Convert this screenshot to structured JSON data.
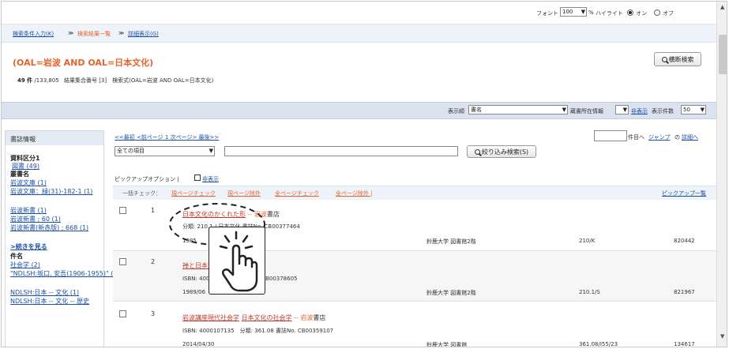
{
  "topbar": {
    "font_label": "フォント",
    "font_value": "100",
    "percent_label": "%",
    "highlight_label": "ハイライト",
    "on_label": "オン",
    "off_label": "オフ"
  },
  "breadcrumb": {
    "step1": "検索条件入力(K)",
    "step2": "検索結果一覧",
    "step3": "詳細表示(G)",
    "sep": "≫"
  },
  "query": {
    "title": "(OAL=岩波 AND OAL=日本文化)",
    "count": "49 件",
    "total": "/133,805",
    "info": "結果集合番号 [3]　検索式(OAL=岩波 AND OAL=日本文化)",
    "cross_search": "横断検索"
  },
  "display_bar": {
    "order_label": "表示順",
    "order_value": "書名",
    "holdings_label": "蔵書所在情報",
    "hide_label": "非表示",
    "count_label": "表示件数",
    "count_value": "50"
  },
  "pager": {
    "text": "<<最初 <前ページ 1 次ページ> 最後>>",
    "jump_suffix": "件目へ",
    "jump": "ジャンプ",
    "prev_sep": "の",
    "detail": "詳細へ"
  },
  "filter": {
    "scope": "全ての項目",
    "button": "絞り込み検索(S)"
  },
  "pickup": {
    "label": "ピックアップオプション |",
    "hide": "非表示",
    "bulk": "一括チェック：",
    "page_check": "現ページチェック",
    "page_exclude": "現ページ除外",
    "all_check": "全ページチェック",
    "all_exclude": "全ページ除外 |",
    "list": "ピックアップ一覧"
  },
  "sidebar": {
    "title": "書誌情報",
    "sections": [
      {
        "head": "資料区分1",
        "items": [
          "図書 (49)"
        ]
      },
      {
        "head": "叢書名",
        "items": [
          "岩波文庫 (1)",
          "岩波文庫：緑(31)-182-1 (1)",
          "岩波新書 (1)",
          "岩波新書 ; 60 (1)",
          "岩波新書(新赤版) ; 668 (1)"
        ]
      },
      {
        "head": "",
        "items": [
          ">続きを見る"
        ]
      },
      {
        "head": "件名",
        "items": [
          "社会学 (2)",
          "\"NDLSH:坂口, 安吾(1906-1955)\" (1)",
          "NDLSH:日本 -- 文化 (1)",
          "NDLSH:日本 -- 文化 -- 歴史"
        ]
      }
    ]
  },
  "results": [
    {
      "num": "1",
      "title": "日本文化のかくれた形",
      "publisher_sep": "-- 岩波",
      "publisher_rest": "書店",
      "line2": "分類: 210.1 / 日本文化 書誌No. CB00377464",
      "date": "1985",
      "location": "鈴鹿大学 図書館2階",
      "call": "210/K",
      "id": "820442"
    },
    {
      "num": "2",
      "title": "禅と日本文化",
      "line2": "ISBN: 4004 ... 210.1 書誌No. CB00378605",
      "date": "1989/06",
      "location": "鈴鹿大学 図書館2階",
      "call": "210.1/S",
      "id": "821967"
    },
    {
      "num": "3",
      "title": "岩波講座現代社会学",
      "title2": "日本文化の社会学",
      "publisher_sep": "-- 岩波",
      "publisher_rest": "書店",
      "line2": "ISBN: 4000107135　分類: 361.08 書誌No. CB00359107",
      "date": "2014/04/30",
      "location": "鈴鹿大学 図書館",
      "call": "361.08/I55/23",
      "id": "134617"
    }
  ],
  "colors": {
    "link": "#1a4fa8",
    "accent": "#e8632b",
    "bar": "#d9e2ee"
  }
}
